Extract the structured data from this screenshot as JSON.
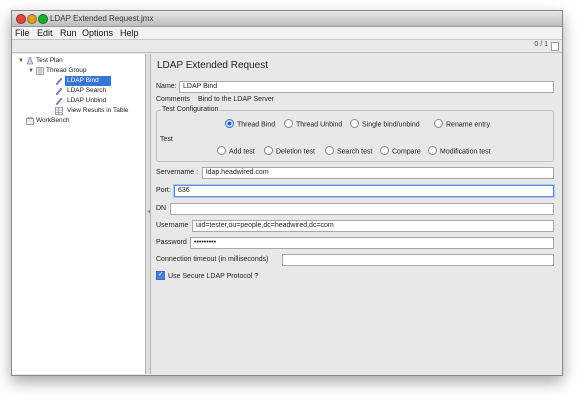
{
  "window": {
    "title": "LDAP Extended Request.jmx"
  },
  "menu": [
    "File",
    "Edit",
    "Run",
    "Options",
    "Help"
  ],
  "toolbar": {
    "counter": "0 / 1"
  },
  "tree": {
    "items": [
      {
        "label": "Test Plan",
        "icon": "test-plan-icon"
      },
      {
        "label": "Thread Group",
        "icon": "thread-group-icon"
      },
      {
        "label": "LDAP Bind",
        "icon": "sampler-icon",
        "selected": true
      },
      {
        "label": "LDAP Search",
        "icon": "sampler-icon"
      },
      {
        "label": "LDAP Unbind",
        "icon": "sampler-icon"
      },
      {
        "label": "View Results in Table",
        "icon": "listener-icon"
      },
      {
        "label": "WorkBench",
        "icon": "workbench-icon"
      }
    ]
  },
  "panel": {
    "heading": "LDAP Extended Request",
    "name_label": "Name:",
    "name_value": "LDAP Bind",
    "comments_label": "Comments",
    "comments_value": "Bind to the LDAP Server",
    "test_config_title": "Test Configuration",
    "test_label": "Test",
    "radio_options": [
      {
        "label": "Thread Bind",
        "selected": true
      },
      {
        "label": "Thread Unbind",
        "selected": false
      },
      {
        "label": "Single bind/unbind",
        "selected": false
      },
      {
        "label": "Rename entry",
        "selected": false
      },
      {
        "label": "Add test",
        "selected": false
      },
      {
        "label": "Deletion test",
        "selected": false
      },
      {
        "label": "Search test",
        "selected": false
      },
      {
        "label": "Compare",
        "selected": false
      },
      {
        "label": "Modification test",
        "selected": false
      }
    ],
    "servername_label": "Servername :",
    "servername_value": "ldap.headwired.com",
    "port_label": "Port:",
    "port_value": "636",
    "dn_label": "DN",
    "dn_value": "",
    "username_label": "Username",
    "username_value": "uid=tester,ou=people,dc=headwired,dc=com",
    "password_label": "Password",
    "password_value": "•••••••••",
    "timeout_label": "Connection timeout (in milliseconds)",
    "timeout_value": "",
    "secure_label": "Use Secure LDAP Protocol ?",
    "secure_checked": true
  },
  "colors": {
    "selection": "#3875d7",
    "focus_ring": "#5c8fd6"
  }
}
